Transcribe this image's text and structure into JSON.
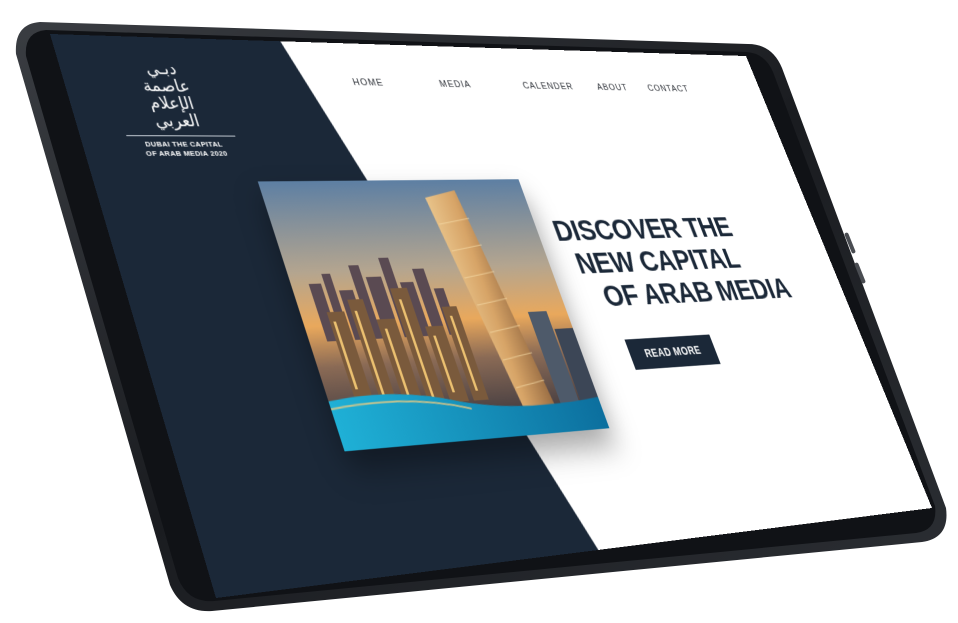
{
  "brand": {
    "logo_arabic_lines": [
      "دبـي",
      "عاصمة",
      "الإعلام",
      "العربي"
    ],
    "logo_caption_line1": "DUBAI THE CAPITAL",
    "logo_caption_line2": "OF ARAB MEDIA 2020"
  },
  "nav": {
    "items": [
      {
        "label": "HOME"
      },
      {
        "label": "MEDIA"
      },
      {
        "label": "CALENDER"
      },
      {
        "label": "ABOUT"
      },
      {
        "label": "CONTACT"
      }
    ]
  },
  "hero": {
    "headline_line1": "DISCOVER THE",
    "headline_line2": "NEW CAPITAL",
    "headline_line3": "OF ARAB MEDIA",
    "cta_label": "READ MORE",
    "photo_icon": "city-skyline-photo"
  },
  "colors": {
    "navy": "#1b2838",
    "frame": "#1e2126",
    "page_bg": "#ffffff"
  }
}
